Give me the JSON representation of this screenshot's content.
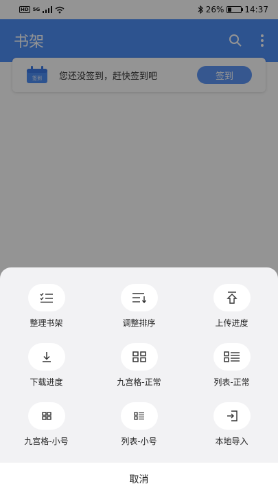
{
  "status_bar": {
    "hd": "HD",
    "signal_label": "5G",
    "battery_percent": "26%",
    "battery_level": 0.26,
    "time": "14:37"
  },
  "header": {
    "title": "书架",
    "icons": [
      "search-icon",
      "more-vert-icon"
    ]
  },
  "checkin": {
    "badge": "签到",
    "message": "您还没签到，赶快签到吧",
    "button_label": "签到"
  },
  "sheet": {
    "items": [
      {
        "label": "整理书架",
        "icon": "manage-list-icon"
      },
      {
        "label": "调整排序",
        "icon": "sort-icon"
      },
      {
        "label": "上传进度",
        "icon": "upload-icon"
      },
      {
        "label": "下载进度",
        "icon": "download-icon"
      },
      {
        "label": "九宫格-正常",
        "icon": "grid-normal-icon"
      },
      {
        "label": "列表-正常",
        "icon": "list-normal-icon"
      },
      {
        "label": "九宫格-小号",
        "icon": "grid-small-icon"
      },
      {
        "label": "列表-小号",
        "icon": "list-small-icon"
      },
      {
        "label": "本地导入",
        "icon": "local-import-icon"
      }
    ],
    "cancel_label": "取消"
  },
  "colors": {
    "header_blue": "#4f8ff7",
    "button_blue": "#5e97f6",
    "sheet_bg": "#f2f2f4"
  }
}
